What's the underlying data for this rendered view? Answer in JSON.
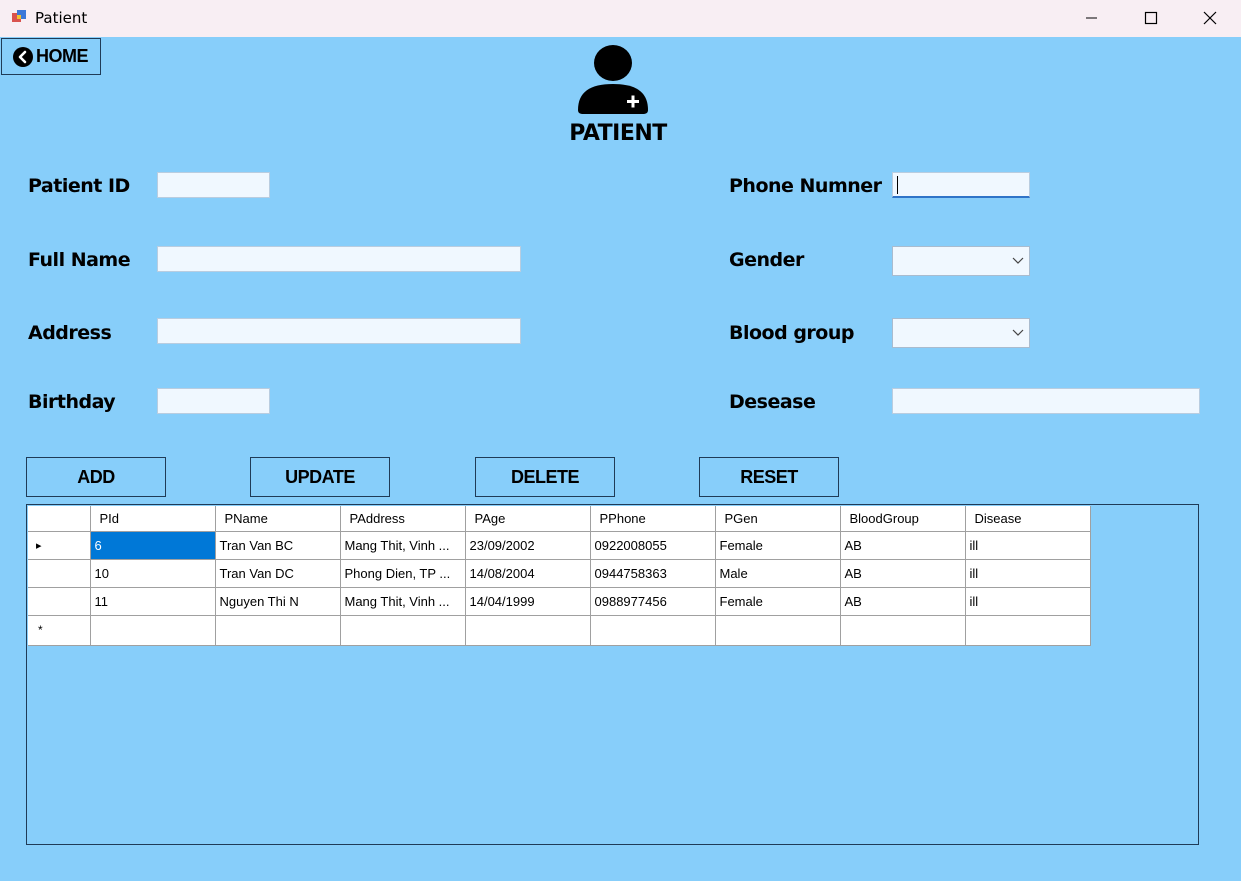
{
  "window": {
    "title": "Patient"
  },
  "home_button": {
    "label": "HOME"
  },
  "page_title": "PATIENT",
  "form": {
    "patient_id": {
      "label": "Patient ID",
      "value": ""
    },
    "full_name": {
      "label": "Full Name",
      "value": ""
    },
    "address": {
      "label": "Address",
      "value": ""
    },
    "birthday": {
      "label": "Birthday",
      "value": ""
    },
    "phone": {
      "label": "Phone Numner",
      "value": ""
    },
    "gender": {
      "label": "Gender",
      "value": ""
    },
    "blood_group": {
      "label": "Blood group",
      "value": ""
    },
    "disease": {
      "label": "Desease",
      "value": ""
    }
  },
  "buttons": {
    "add": "ADD",
    "update": "UPDATE",
    "delete": "DELETE",
    "reset": "RESET"
  },
  "grid": {
    "columns": [
      "PId",
      "PName",
      "PAddress",
      "PAge",
      "PPhone",
      "PGen",
      "BloodGroup",
      "Disease"
    ],
    "rows": [
      [
        "6",
        "Tran Van BC",
        "Mang Thit, Vinh ...",
        "23/09/2002",
        "0922008055",
        "Female",
        "AB",
        "ill"
      ],
      [
        "10",
        "Tran Van DC",
        "Phong Dien, TP ...",
        "14/08/2004",
        "0944758363",
        "Male",
        "AB",
        "ill"
      ],
      [
        "11",
        "Nguyen Thi N",
        "Mang Thit, Vinh ...",
        "14/04/1999",
        "0988977456",
        "Female",
        "AB",
        "ill"
      ]
    ],
    "new_row_marker": "*",
    "current_row_marker": "▸"
  },
  "colors": {
    "background": "#87cefa",
    "selection": "#0078d7",
    "titlebar": "#f8eef3"
  }
}
